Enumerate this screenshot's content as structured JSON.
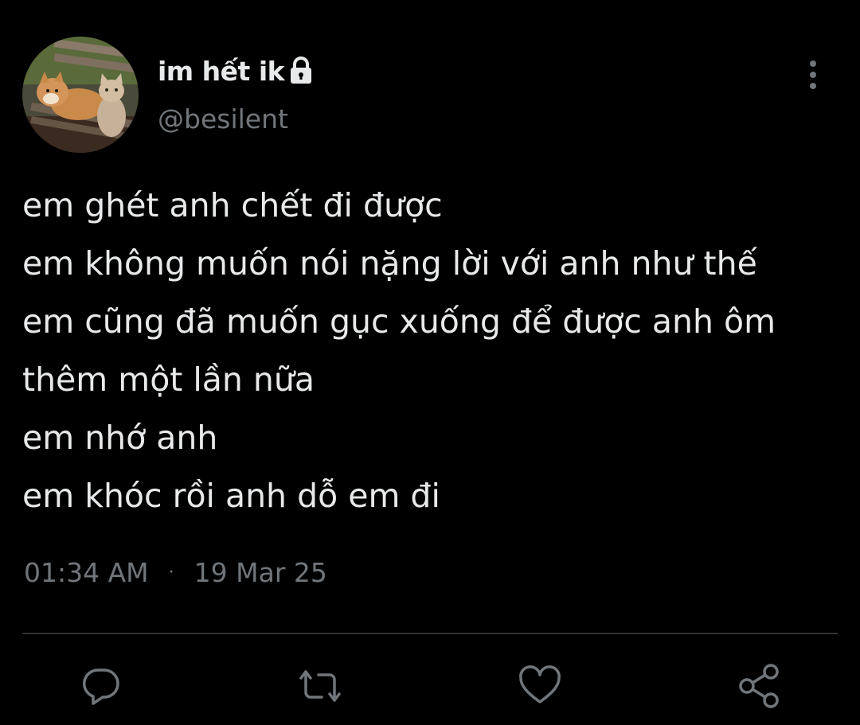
{
  "header": {
    "display_name": "im hết ik",
    "handle": "@besilent",
    "protected_icon": "lock-icon",
    "avatar_icon": "avatar-shiba-and-cat",
    "more_icon": "vertical-ellipsis-icon"
  },
  "tweet": {
    "lines": [
      "em ghét anh chết đi được",
      "em không muốn nói nặng lời với anh như thế",
      "em cũng đã muốn gục xuống để được anh ôm",
      "thêm một lần nữa",
      "em nhớ anh",
      "em khóc rồi anh dỗ em đi"
    ]
  },
  "meta": {
    "time": "01:34 AM",
    "separator": "·",
    "date": "19 Mar 25"
  },
  "actions": [
    {
      "name": "reply",
      "icon": "reply-icon"
    },
    {
      "name": "retweet",
      "icon": "retweet-icon"
    },
    {
      "name": "like",
      "icon": "heart-icon"
    },
    {
      "name": "share",
      "icon": "share-icon"
    }
  ],
  "colors": {
    "background": "#000000",
    "primary_text": "#e7e9ea",
    "secondary_text": "#71767b",
    "divider": "#2f3336"
  }
}
